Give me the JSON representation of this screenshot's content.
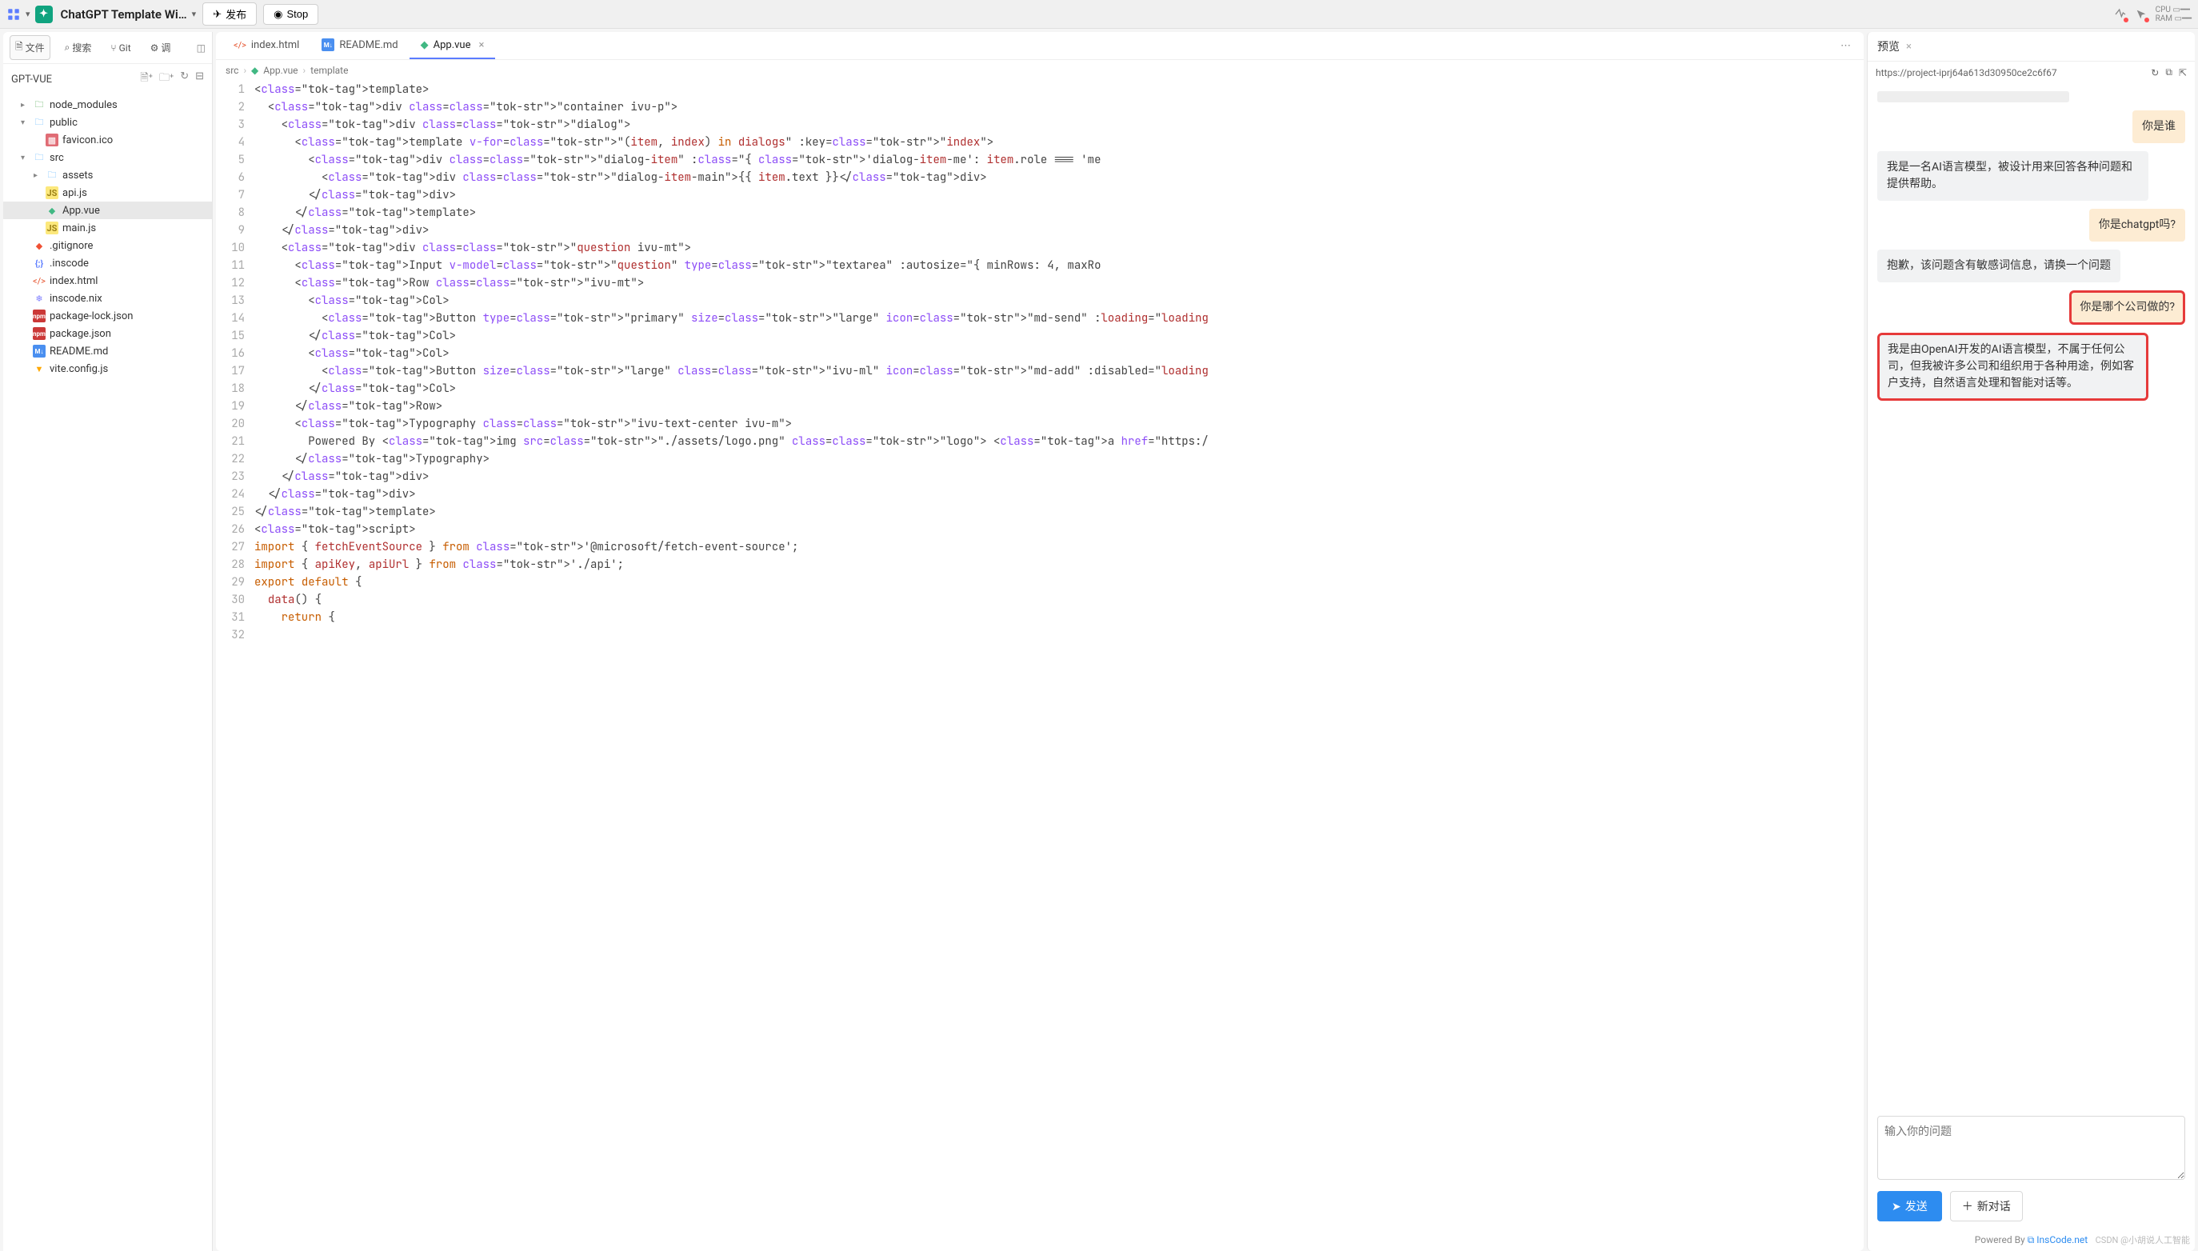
{
  "topbar": {
    "title": "ChatGPT Template Wi…",
    "publish_label": "发布",
    "stop_label": "Stop",
    "cpu_label": "CPU",
    "ram_label": "RAM"
  },
  "sidebar": {
    "tabs": {
      "file": "文件",
      "search": "搜索",
      "git": "Git",
      "debug": "调"
    },
    "project_name": "GPT-VUE",
    "tree": [
      {
        "name": "node_modules",
        "icon": "folder-green",
        "caret": "▸",
        "indent": 1
      },
      {
        "name": "public",
        "icon": "folder",
        "caret": "▾",
        "indent": 1
      },
      {
        "name": "favicon.ico",
        "icon": "img",
        "indent": 2
      },
      {
        "name": "src",
        "icon": "folder",
        "caret": "▾",
        "indent": 1
      },
      {
        "name": "assets",
        "icon": "folder-solid",
        "caret": "▸",
        "indent": 2
      },
      {
        "name": "api.js",
        "icon": "js",
        "indent": 2
      },
      {
        "name": "App.vue",
        "icon": "vue",
        "indent": 2,
        "selected": true
      },
      {
        "name": "main.js",
        "icon": "js",
        "indent": 2
      },
      {
        "name": ".gitignore",
        "icon": "git",
        "indent": 1
      },
      {
        "name": ".inscode",
        "icon": "brace",
        "indent": 1
      },
      {
        "name": "index.html",
        "icon": "html",
        "indent": 1
      },
      {
        "name": "inscode.nix",
        "icon": "nix",
        "indent": 1
      },
      {
        "name": "package-lock.json",
        "icon": "npm",
        "indent": 1
      },
      {
        "name": "package.json",
        "icon": "npm",
        "indent": 1
      },
      {
        "name": "README.md",
        "icon": "md",
        "indent": 1
      },
      {
        "name": "vite.config.js",
        "icon": "vite",
        "indent": 1
      }
    ]
  },
  "editor": {
    "tabs": [
      {
        "label": "index.html",
        "icon": "html"
      },
      {
        "label": "README.md",
        "icon": "md"
      },
      {
        "label": "App.vue",
        "icon": "vue",
        "active": true,
        "closable": true
      }
    ],
    "breadcrumb": [
      "src",
      "App.vue",
      "template"
    ],
    "lines": [
      "<template>",
      "  <div class=\"container ivu-p\">",
      "    <div class=\"dialog\">",
      "      <template v-for=\"(item, index) in dialogs\" :key=\"index\">",
      "        <div class=\"dialog-item\" :class=\"{ 'dialog-item-me': item.role === 'me",
      "          <div class=\"dialog-item-main\">{{ item.text }}</div>",
      "        </div>",
      "      </template>",
      "    </div>",
      "    <div class=\"question ivu-mt\">",
      "      <Input v-model=\"question\" type=\"textarea\" :autosize=\"{ minRows: 4, maxRo",
      "      <Row class=\"ivu-mt\">",
      "        <Col>",
      "          <Button type=\"primary\" size=\"large\" icon=\"md-send\" :loading=\"loading",
      "        </Col>",
      "        <Col>",
      "          <Button size=\"large\" class=\"ivu-ml\" icon=\"md-add\" :disabled=\"loading",
      "        </Col>",
      "      </Row>",
      "      <Typography class=\"ivu-text-center ivu-m\">",
      "        Powered By <img src=\"./assets/logo.png\" class=\"logo\"> <a href=\"https:/",
      "      </Typography>",
      "    </div>",
      "  </div>",
      "</template>",
      "<script>",
      "import { fetchEventSource } from '@microsoft/fetch-event-source';",
      "import { apiKey, apiUrl } from './api';",
      "",
      "export default {",
      "  data() {",
      "    return {"
    ]
  },
  "preview": {
    "title": "预览",
    "url": "https://project-iprj64a613d30950ce2c6f67",
    "messages": [
      {
        "side": "right",
        "text": "你是谁"
      },
      {
        "side": "left",
        "text": "我是一名AI语言模型，被设计用来回答各种问题和提供帮助。"
      },
      {
        "side": "right",
        "text": "你是chatgpt吗?"
      },
      {
        "side": "left",
        "text": "抱歉，该问题含有敏感词信息，请换一个问题"
      },
      {
        "side": "right",
        "text": "你是哪个公司做的?",
        "highlight": true
      },
      {
        "side": "left",
        "text": "我是由OpenAI开发的AI语言模型，不属于任何公司，但我被许多公司和组织用于各种用途，例如客户支持，自然语言处理和智能对话等。",
        "highlight": true
      }
    ],
    "input_placeholder": "输入你的问题",
    "send_label": "发送",
    "new_chat_label": "新对话",
    "footer_prefix": "Powered By ",
    "footer_link": "InsCode.net"
  },
  "watermark": "CSDN @小胡说人工智能"
}
